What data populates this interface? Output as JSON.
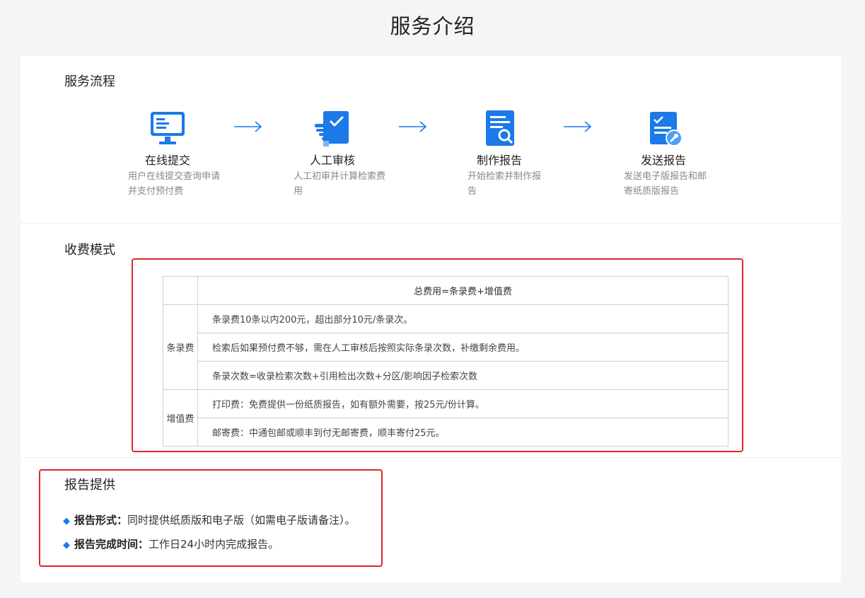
{
  "page": {
    "title": "服务介绍"
  },
  "flow": {
    "title": "服务流程",
    "steps": [
      {
        "title": "在线提交",
        "desc": "用户在线提交查询申请并支付预付费",
        "icon": "monitor-icon"
      },
      {
        "title": "人工审核",
        "desc": "人工初审并计算检索费用",
        "icon": "hand-check-icon"
      },
      {
        "title": "制作报告",
        "desc": "开始检索并制作报告",
        "icon": "document-search-icon"
      },
      {
        "title": "发送报告",
        "desc": "发送电子版报告和邮寄纸质版报告",
        "icon": "document-wrench-icon"
      }
    ]
  },
  "fee": {
    "title": "收费模式",
    "header": "总费用=条录费+增值费",
    "groups": [
      {
        "name": "条录费",
        "rows": [
          "条录费10条以内200元，超出部分10元/条录次。",
          "检索后如果预付费不够，需在人工审核后按照实际条录次数，补缴剩余费用。",
          "条录次数=收录检索次数+引用检出次数+分区/影响因子检索次数"
        ]
      },
      {
        "name": "增值费",
        "rows": [
          "打印费：免费提供一份纸质报告，如有额外需要，按25元/份计算。",
          "邮寄费：中通包邮或顺丰到付无邮寄费，顺丰寄付25元。"
        ]
      }
    ]
  },
  "report": {
    "title": "报告提供",
    "items": [
      {
        "label": "报告形式：",
        "text": "同时提供纸质版和电子版（如需电子版请备注）。"
      },
      {
        "label": "报告完成时间：",
        "text": "工作日24小时内完成报告。"
      }
    ]
  },
  "colors": {
    "accent": "#1b79e8",
    "highlight": "#e0262b"
  }
}
